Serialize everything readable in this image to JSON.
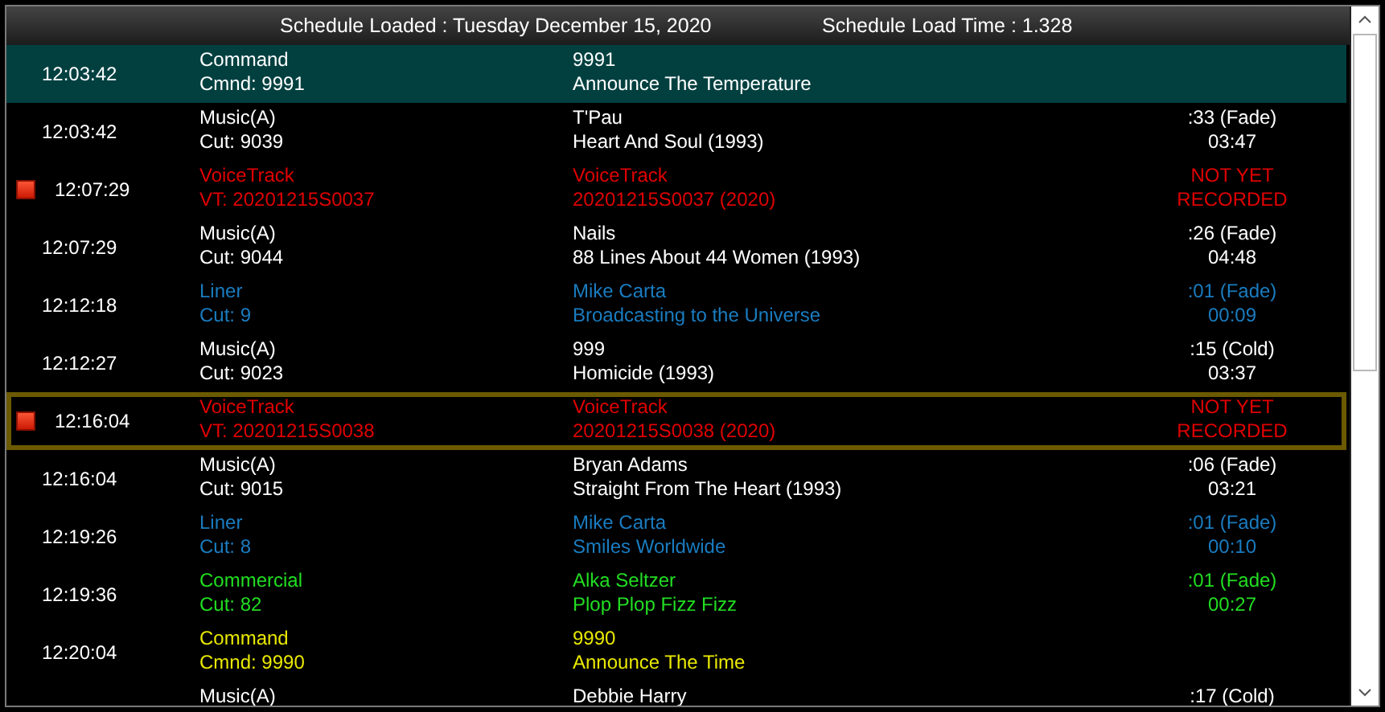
{
  "header": {
    "loaded": "Schedule Loaded : Tuesday December 15, 2020",
    "load_time": "Schedule Load Time : 1.328"
  },
  "rows": [
    {
      "time": "12:03:42",
      "type": "Command",
      "cut": "Cmnd: 9991",
      "artist": "9991",
      "title": "Announce The Temperature",
      "color": "#ffffff",
      "selected": true,
      "focused": false,
      "marker": false
    },
    {
      "time": "12:03:42",
      "type": "Music(A)",
      "cut": "Cut: 9039",
      "artist": "T'Pau",
      "title": "Heart And Soul (1993)",
      "segue": ":33 (Fade)",
      "length": "03:47",
      "color": "#ffffff",
      "selected": false,
      "focused": false,
      "marker": false
    },
    {
      "time": "12:07:29",
      "type": "VoiceTrack",
      "cut": "VT: 20201215S0037",
      "artist": "VoiceTrack",
      "title": "20201215S0037 (2020)",
      "note": "NOT YET RECORDED",
      "color": "#e00000",
      "selected": false,
      "focused": false,
      "marker": true
    },
    {
      "time": "12:07:29",
      "type": "Music(A)",
      "cut": "Cut: 9044",
      "artist": "Nails",
      "title": "88 Lines About 44 Women (1993)",
      "segue": ":26 (Fade)",
      "length": "04:48",
      "color": "#ffffff",
      "selected": false,
      "focused": false,
      "marker": false
    },
    {
      "time": "12:12:18",
      "type": "Liner",
      "cut": "Cut: 9",
      "artist": "Mike Carta",
      "title": "Broadcasting to the Universe",
      "segue": ":01 (Fade)",
      "length": "00:09",
      "color": "#1a7cc0",
      "selected": false,
      "focused": false,
      "marker": false
    },
    {
      "time": "12:12:27",
      "type": "Music(A)",
      "cut": "Cut: 9023",
      "artist": "999",
      "title": "Homicide (1993)",
      "segue": ":15 (Cold)",
      "length": "03:37",
      "color": "#ffffff",
      "selected": false,
      "focused": false,
      "marker": false
    },
    {
      "time": "12:16:04",
      "type": "VoiceTrack",
      "cut": "VT: 20201215S0038",
      "artist": "VoiceTrack",
      "title": "20201215S0038 (2020)",
      "note": "NOT YET RECORDED",
      "color": "#e00000",
      "selected": false,
      "focused": true,
      "marker": true
    },
    {
      "time": "12:16:04",
      "type": "Music(A)",
      "cut": "Cut: 9015",
      "artist": "Bryan Adams",
      "title": "Straight From The Heart (1993)",
      "segue": ":06 (Fade)",
      "length": "03:21",
      "color": "#ffffff",
      "selected": false,
      "focused": false,
      "marker": false
    },
    {
      "time": "12:19:26",
      "type": "Liner",
      "cut": "Cut: 8",
      "artist": "Mike Carta",
      "title": "Smiles Worldwide",
      "segue": ":01 (Fade)",
      "length": "00:10",
      "color": "#1a7cc0",
      "selected": false,
      "focused": false,
      "marker": false
    },
    {
      "time": "12:19:36",
      "type": "Commercial",
      "cut": "Cut: 82",
      "artist": "Alka Seltzer",
      "title": "Plop Plop Fizz Fizz",
      "segue": ":01 (Fade)",
      "length": "00:27",
      "color": "#22dd22",
      "selected": false,
      "focused": false,
      "marker": false
    },
    {
      "time": "12:20:04",
      "type": "Command",
      "cut": "Cmnd: 9990",
      "artist": "9990",
      "title": "Announce The Time",
      "color": "#e8e800",
      "selected": false,
      "focused": false,
      "marker": false
    },
    {
      "type": "Music(A)",
      "artist": "Debbie Harry",
      "segue": ":17 (Cold)",
      "color": "#ffffff",
      "selected": false,
      "focused": false,
      "marker": false
    }
  ]
}
